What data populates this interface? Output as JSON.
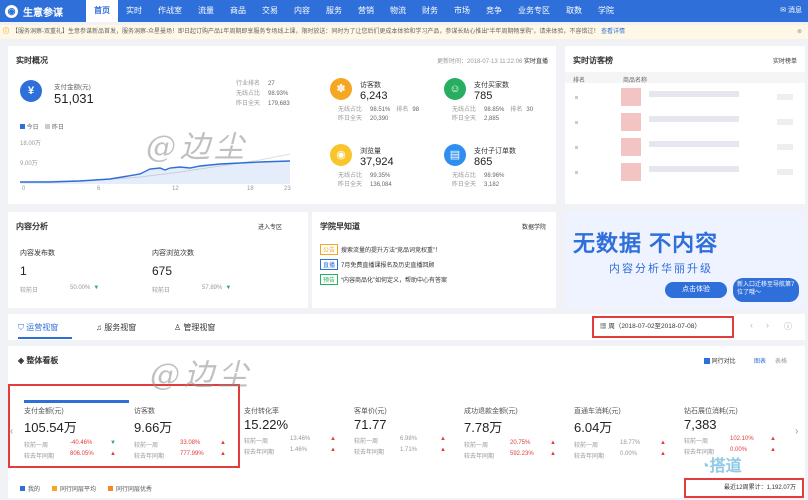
{
  "nav": {
    "app_title": "生意参谋",
    "items": [
      "首页",
      "实时",
      "作战室",
      "流量",
      "商品",
      "交易",
      "内容",
      "服务",
      "营销",
      "物流",
      "财务",
      "市场",
      "竞争",
      "业务专区",
      "取数",
      "学院"
    ],
    "message": "消息"
  },
  "notice": {
    "text": "【服务洞察-双重礼】生意参谋新品首发，服务洞察-众星曼场！即日起订购产品1年周期即享服务专场线上课，限时放送：同时为了让您后们更成本体验和学习产品，参谋长贴心推出“半年周期畅享购”，请来体验，不容错过！",
    "link": "查看详情"
  },
  "realtime": {
    "title": "实时概况",
    "update_time": "更新时间：2018-07-13 11:22:06",
    "live_link": "实时直播",
    "pay_amount": {
      "label": "支付金额(元)",
      "value": "51,031"
    },
    "side_stats": [
      {
        "label": "行业排名",
        "value": "27"
      },
      {
        "label": "无线占比",
        "value": "98.93%"
      },
      {
        "label": "昨日全天",
        "value": "179,683"
      }
    ],
    "legend": {
      "today": "今日",
      "yesterday": "昨日"
    },
    "y_ticks": [
      "18.00万",
      "9.00万"
    ],
    "x_ticks": [
      "0",
      "6",
      "12",
      "18",
      "23"
    ],
    "metrics": [
      {
        "label": "访客数",
        "value": "6,243",
        "l1": "无线占比",
        "v1": "98.51%",
        "extra_label": "排名",
        "extra_value": "98",
        "l2": "昨日全天",
        "v2": "20,390",
        "color": "#f5a623",
        "icon": "footprint-icon"
      },
      {
        "label": "支付买家数",
        "value": "785",
        "l1": "无线占比",
        "v1": "98.85%",
        "extra_label": "排名",
        "extra_value": "30",
        "l2": "昨日全天",
        "v2": "2,885",
        "color": "#27ae60",
        "icon": "user-icon"
      },
      {
        "label": "浏览量",
        "value": "37,924",
        "l1": "无线占比",
        "v1": "99.35%",
        "extra_label": "",
        "extra_value": "",
        "l2": "昨日全天",
        "v2": "136,084",
        "color": "#f8c52c",
        "icon": "eye-icon"
      },
      {
        "label": "支付子订单数",
        "value": "865",
        "l1": "无线占比",
        "v1": "98.96%",
        "extra_label": "",
        "extra_value": "",
        "l2": "昨日全天",
        "v2": "3,182",
        "color": "#2f8ff0",
        "icon": "order-icon"
      }
    ]
  },
  "visitor_rank": {
    "title": "实时访客榜",
    "more": "实时榜单",
    "col_rank": "排名",
    "col_product": "商品名称"
  },
  "content_analysis": {
    "title": "内容分析",
    "link": "进入专区",
    "stats": [
      {
        "label": "内容发布数",
        "value": "1",
        "cmp": "较前日",
        "pct": "50.00%"
      },
      {
        "label": "内容浏览次数",
        "value": "675",
        "cmp": "较前日",
        "pct": "57.89%"
      }
    ]
  },
  "academy": {
    "title": "学院早知道",
    "link": "数据学院",
    "items": [
      {
        "tag": "公告",
        "text": "搜索流量的提升方法“竞品词竞权重”！"
      },
      {
        "tag": "直播",
        "text": "7月免费直播课报名及历史直播回顾"
      },
      {
        "tag": "预告",
        "text": "“内容商品化”如何定义，帮助中心有答案"
      }
    ]
  },
  "banner": {
    "line1": "无数据 不内容",
    "line2": "内容分析华丽升级",
    "button": "点击体验",
    "badge": "新入口迁移至导航第7位了哦～"
  },
  "tabs": [
    "运营视窗",
    "服务视窗",
    "管理视窗"
  ],
  "date_range": {
    "label": "周",
    "value": "2018-07-02至2018-07-08"
  },
  "overview": {
    "title": "整体看板",
    "checkbox": "同行对比",
    "chart_label": "图表",
    "table_label": "表格"
  },
  "kpis": [
    {
      "label": "支付金额(元)",
      "value": "105.54万",
      "r1": "较前一周",
      "p1": "-40.46%",
      "r2": "较去年同期",
      "p2": "806.05%"
    },
    {
      "label": "访客数",
      "value": "9.66万",
      "r1": "较前一周",
      "p1": "33.08%",
      "r2": "较去年同期",
      "p2": "777.99%"
    },
    {
      "label": "支付转化率",
      "value": "15.22%",
      "r1": "较前一周",
      "p1": "13.46%",
      "r2": "较去年同期",
      "p2": "1.46%"
    },
    {
      "label": "客单价(元)",
      "value": "71.77",
      "r1": "较前一周",
      "p1": "6.98%",
      "r2": "较去年同期",
      "p2": "1.71%"
    },
    {
      "label": "成功退款金额(元)",
      "value": "7.78万",
      "r1": "较前一周",
      "p1": "20.75%",
      "r2": "较去年同期",
      "p2": "592.23%"
    },
    {
      "label": "直通车消耗(元)",
      "value": "6.04万",
      "r1": "较前一周",
      "p1": "18.77%",
      "r2": "较去年同期",
      "p2": "0.00%"
    },
    {
      "label": "钻石展位消耗(元)",
      "value": "7,383",
      "r1": "较前一周",
      "p1": "102.10%",
      "r2": "较去年同期",
      "p2": "0.00%"
    }
  ],
  "legend_bottom": [
    "我的",
    "同行同层平均",
    "同行同层优秀"
  ],
  "total": "最近12周累计：1,192.07万",
  "watermark": "@边尘",
  "site_logo": "搭道"
}
